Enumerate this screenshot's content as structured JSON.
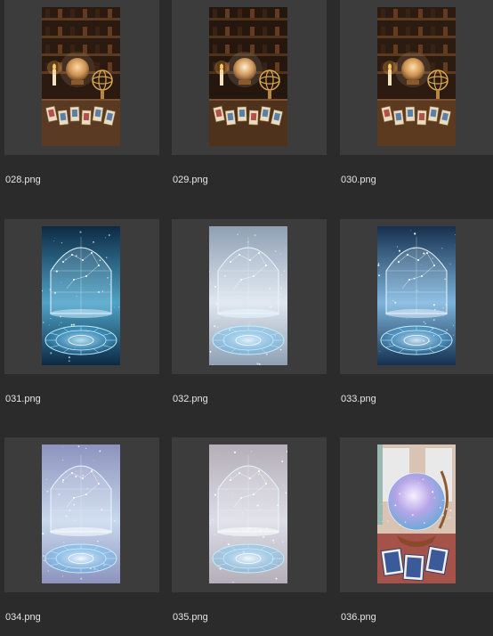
{
  "colors": {
    "background": "#2b2b2b",
    "tile": "#3c3c3c",
    "label": "#e6e6e6"
  },
  "files": [
    {
      "name": "028.png",
      "thumb": "astrology-desk-crystal-ball-tarot",
      "palette": [
        "#2a1a10",
        "#5a3a22",
        "#ffd9a0"
      ]
    },
    {
      "name": "029.png",
      "thumb": "astrology-desk-crystal-ball-tarot",
      "palette": [
        "#25170e",
        "#4e321c",
        "#fff0d0"
      ]
    },
    {
      "name": "030.png",
      "thumb": "astrology-desk-crystal-ball-tarot",
      "palette": [
        "#2c1b10",
        "#5c3a20",
        "#ffe0a8"
      ]
    },
    {
      "name": "031.png",
      "thumb": "glass-dome-zodiac-circle",
      "palette": [
        "#0c2a44",
        "#4fa3c8",
        "#cfefff"
      ]
    },
    {
      "name": "032.png",
      "thumb": "glass-dome-zodiac-circle",
      "palette": [
        "#8fa0b4",
        "#dfe6ee",
        "#eaf6ff"
      ]
    },
    {
      "name": "033.png",
      "thumb": "glass-dome-zodiac-circle",
      "palette": [
        "#16304f",
        "#7db4dc",
        "#e3f3ff"
      ]
    },
    {
      "name": "034.png",
      "thumb": "glass-dome-zodiac-circle",
      "palette": [
        "#8c93bd",
        "#c8d8ee",
        "#ffffff"
      ]
    },
    {
      "name": "035.png",
      "thumb": "glass-dome-zodiac-circle",
      "palette": [
        "#b4aeb8",
        "#dcdde6",
        "#ffffff"
      ]
    },
    {
      "name": "036.png",
      "thumb": "crystal-ball-globe-tarot",
      "palette": [
        "#d9c4b4",
        "#a5524a",
        "#f6f0ff"
      ]
    }
  ]
}
